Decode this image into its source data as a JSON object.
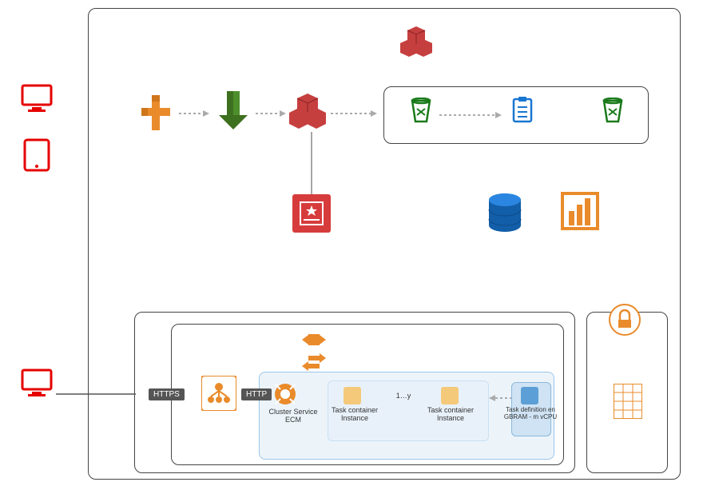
{
  "clients_top": [
    {
      "icon": "desktop"
    },
    {
      "icon": "tablet"
    }
  ],
  "client_bottom": {
    "icon": "desktop"
  },
  "protocols": {
    "https": "HTTPS",
    "http": "HTTP"
  },
  "top_flow": {
    "step1": {
      "icon": "cloudfront",
      "color": "#e98b2b"
    },
    "step2": {
      "icon": "s3",
      "color": "#4d8f2c"
    },
    "step3": {
      "icon": "api-gateway",
      "color": "#c63f3f"
    }
  },
  "stack_top": {
    "icon": "distribution",
    "color": "#c63f3f"
  },
  "cert": {
    "icon": "certificate-manager",
    "color": "#d73c3c"
  },
  "step_functions_group": {
    "items": [
      {
        "icon": "bucket",
        "color": "#1a7a1a"
      },
      {
        "icon": "task-list",
        "color": "#1976d2"
      },
      {
        "icon": "bucket",
        "color": "#1a7a1a"
      }
    ]
  },
  "datastores": {
    "db": {
      "icon": "dynamodb",
      "color": "#1976d2"
    },
    "metrics": {
      "icon": "cloudwatch",
      "color": "#e98b2b"
    }
  },
  "ecs": {
    "outer": {},
    "autoscaling_group": {
      "icon_top": {
        "icon": "autoscaling",
        "color": "#e98b2b"
      },
      "icon_mid": {
        "icon": "autoscaling",
        "color": "#e98b2b"
      },
      "cluster": {
        "label": "Cluster Service ECM",
        "alb_icon": {
          "icon": "load-balancer",
          "color": "#e98b2b"
        },
        "listener_icon": {
          "icon": "target-group",
          "color": "#e98b2b"
        },
        "tasks": {
          "task1_label": "Task container Instance",
          "range_label": "1…y",
          "task2_label": "Task container Instance"
        },
        "task_def": {
          "label": "Task definition en GBRAM - m vCPU"
        }
      }
    }
  },
  "right_panel": {
    "icon_top": {
      "icon": "ecr",
      "color": "#e98b2b"
    },
    "icon_mid": {
      "icon": "grid",
      "color": "#e98b2b"
    }
  }
}
